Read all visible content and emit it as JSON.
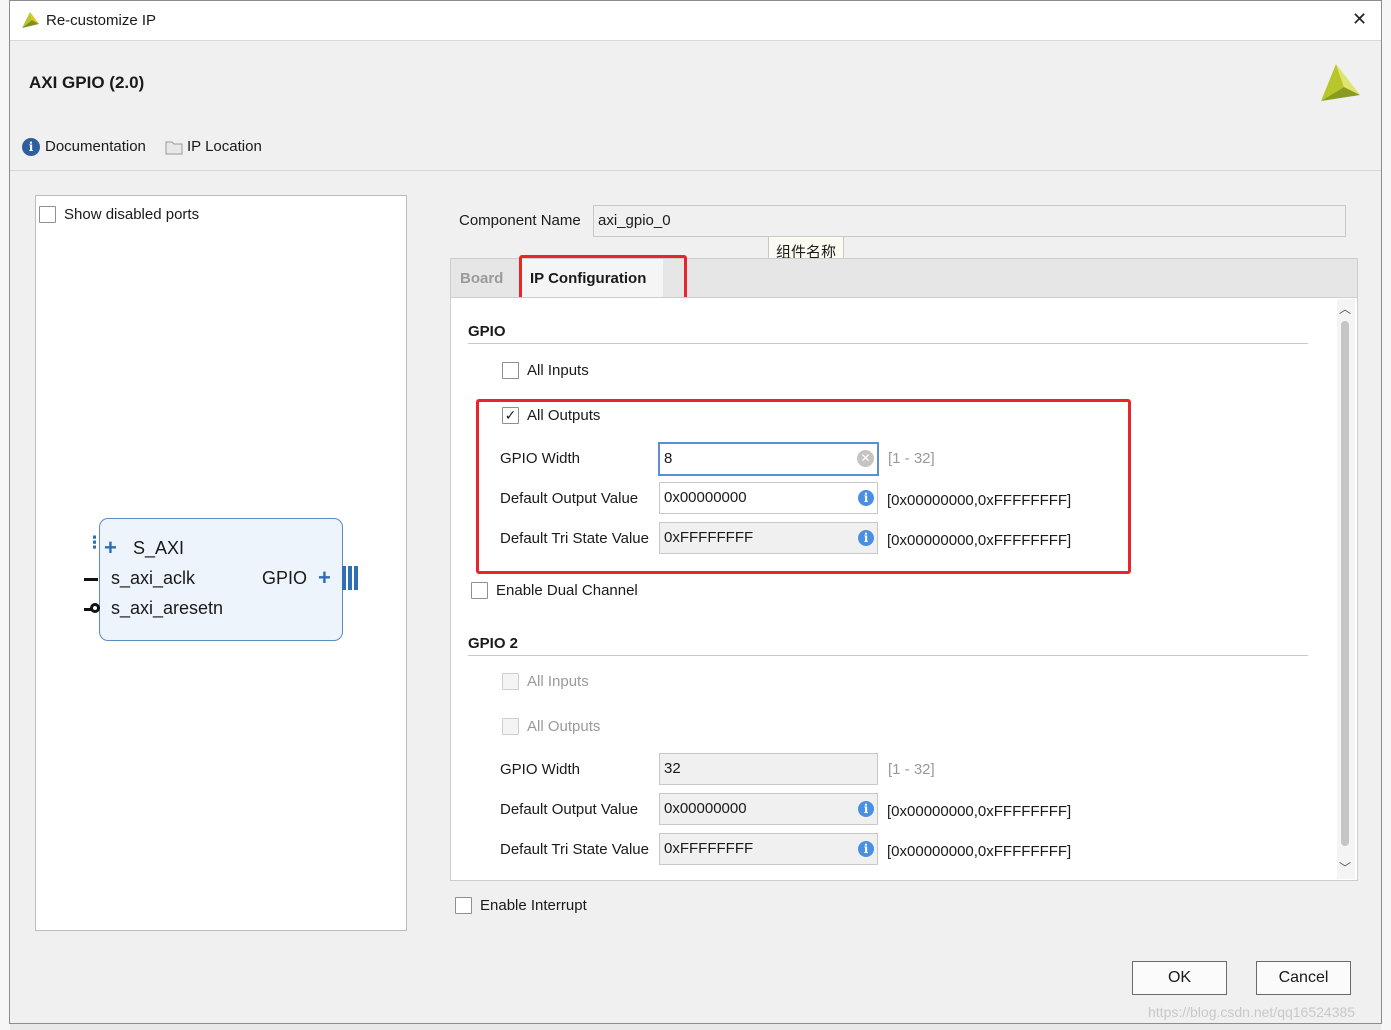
{
  "window": {
    "title": "Re-customize IP",
    "close_glyph": "✕"
  },
  "header": {
    "ip_name": "AXI GPIO (2.0)",
    "documentation_label": "Documentation",
    "ip_location_label": "IP Location"
  },
  "left_panel": {
    "show_disabled_ports_label": "Show disabled ports",
    "block": {
      "ports_left": [
        "S_AXI",
        "s_axi_aclk",
        "s_axi_aresetn"
      ],
      "port_right": "GPIO"
    }
  },
  "component": {
    "label": "Component Name",
    "value": "axi_gpio_0",
    "tooltip": "组件名称"
  },
  "tabs": [
    {
      "label": "Board"
    },
    {
      "label": "IP Configuration"
    }
  ],
  "gpio": {
    "section_title": "GPIO",
    "all_inputs_label": "All Inputs",
    "all_outputs_label": "All Outputs",
    "all_outputs_checked": true,
    "width_label": "GPIO Width",
    "width_value": "8",
    "width_range": "[1 - 32]",
    "default_output_label": "Default Output Value",
    "default_output_value": "0x00000000",
    "default_output_range": "[0x00000000,0xFFFFFFFF]",
    "tri_state_label": "Default Tri State Value",
    "tri_state_value": "0xFFFFFFFF",
    "tri_state_range": "[0x00000000,0xFFFFFFFF]",
    "dual_channel_label": "Enable Dual Channel"
  },
  "gpio2": {
    "section_title": "GPIO 2",
    "all_inputs_label": "All Inputs",
    "all_outputs_label": "All Outputs",
    "width_label": "GPIO Width",
    "width_value": "32",
    "width_range": "[1 - 32]",
    "default_output_label": "Default Output Value",
    "default_output_value": "0x00000000",
    "default_output_range": "[0x00000000,0xFFFFFFFF]",
    "tri_state_label": "Default Tri State Value",
    "tri_state_value": "0xFFFFFFFF",
    "tri_state_range": "[0x00000000,0xFFFFFFFF]"
  },
  "interrupt_label": "Enable Interrupt",
  "buttons": {
    "ok": "OK",
    "cancel": "Cancel"
  },
  "watermark": "https://blog.csdn.net/qq16524385",
  "colors": {
    "highlight": "#e8262a",
    "accent": "#4a90e2",
    "logo": "#b7c72a"
  }
}
